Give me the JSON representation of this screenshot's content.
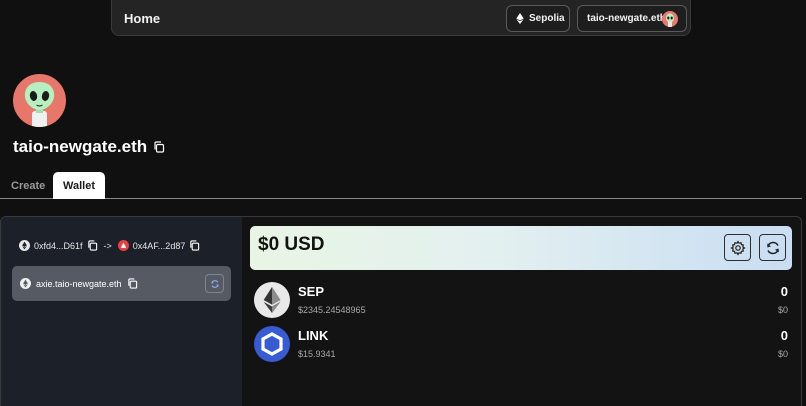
{
  "nav": {
    "home_label": "Home",
    "network_label": "Sepolia",
    "account_label": "taio-newgate.eth"
  },
  "profile": {
    "name": "taio-newgate.eth"
  },
  "tabs": [
    {
      "label": "Create",
      "active": false
    },
    {
      "label": "Wallet",
      "active": true
    }
  ],
  "wallet": {
    "from_address": "0xfd4...D61f",
    "arrow": "->",
    "to_address": "0x4AF...2d87",
    "subdomain": "axie.taio-newgate.eth",
    "balance_usd": "$0 USD",
    "tokens": [
      {
        "symbol": "SEP",
        "price": "$2345.24548965",
        "amount": "0",
        "value": "$0",
        "icon": "ethereum-icon",
        "color": "#e8e8e8"
      },
      {
        "symbol": "LINK",
        "price": "$15.9341",
        "amount": "0",
        "value": "$0",
        "icon": "chainlink-icon",
        "color": "#375bd2"
      }
    ]
  },
  "colors": {
    "background": "#101010",
    "sidebar": "#1c2029",
    "avatar": "#e7776a",
    "chainlink": "#375bd2"
  }
}
